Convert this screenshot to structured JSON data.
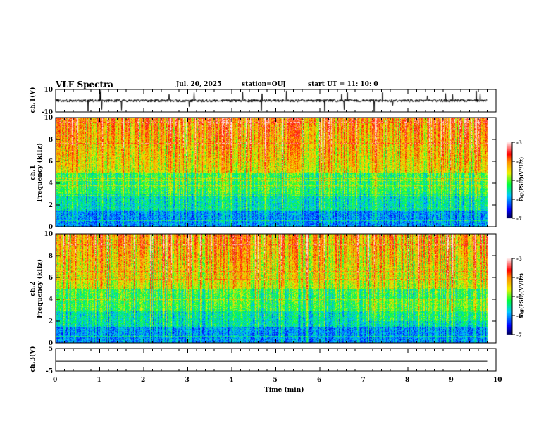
{
  "header": {
    "title": "VLF Spectra",
    "date": "Jul. 20, 2025",
    "station": "station=OUJ",
    "start": "start UT =  11: 10: 0"
  },
  "chart_data": [
    {
      "type": "line",
      "ylabel": "ch.1(V)",
      "ylim": [
        -10,
        10
      ],
      "yticks": [
        "10",
        "-10"
      ],
      "xlim": [
        0,
        10
      ],
      "baseline": 0
    },
    {
      "type": "heatmap",
      "ylabel_top": "ch.1",
      "ylabel_bottom": "Frequency (kHz)",
      "ylim": [
        0,
        10
      ],
      "yticks": [
        "0",
        "2",
        "4",
        "6",
        "8",
        "10"
      ],
      "xlim": [
        0,
        10
      ],
      "data_end_min": 9.8,
      "colorbar": {
        "label": "log(PSD)(V²/Hz)",
        "range": [
          -7,
          -3
        ],
        "ticks": [
          "-3",
          "-4",
          "-5",
          "-6",
          "-7"
        ]
      }
    },
    {
      "type": "heatmap",
      "ylabel_top": "ch.2",
      "ylabel_bottom": "Frequency (kHz)",
      "ylim": [
        0,
        10
      ],
      "yticks": [
        "0",
        "2",
        "4",
        "6",
        "8",
        "10"
      ],
      "xlim": [
        0,
        10
      ],
      "data_end_min": 9.8,
      "colorbar": {
        "label": "log(PSD)(V²/Hz)",
        "range": [
          -7,
          -3
        ],
        "ticks": [
          "-3",
          "-4",
          "-5",
          "-6",
          "-7"
        ]
      }
    },
    {
      "type": "line",
      "ylabel": "ch.3(V)",
      "ylim": [
        -5,
        5
      ],
      "yticks": [
        "5",
        "-5"
      ],
      "xlim": [
        0,
        10
      ],
      "value": -0.5,
      "xlabel": "Time  (min)",
      "xticks": [
        "0",
        "1",
        "2",
        "3",
        "4",
        "5",
        "6",
        "7",
        "8",
        "9",
        "10"
      ]
    }
  ]
}
